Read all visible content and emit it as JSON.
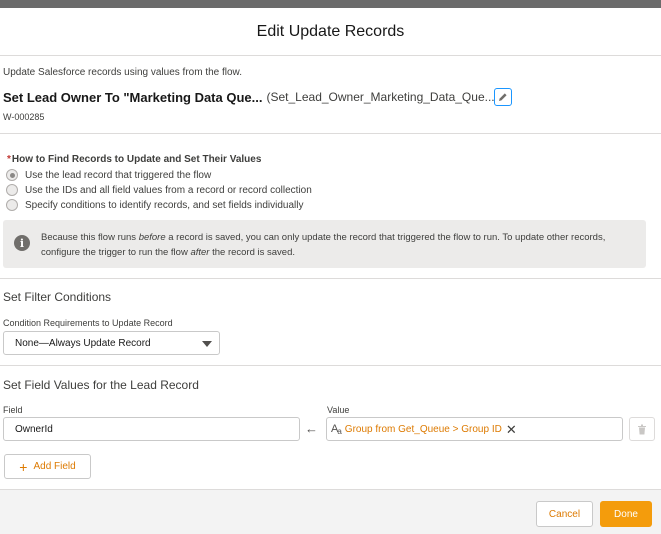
{
  "modal": {
    "title": "Edit Update Records",
    "description": "Update Salesforce records using values from the flow.",
    "element_label": "Set Lead Owner To \"Marketing Data Que...",
    "element_api_name": "(Set_Lead_Owner_Marketing_Data_Que...",
    "element_id": "W-000285"
  },
  "how_to_find": {
    "required_marker": "*",
    "label": "How to Find Records to Update and Set Their Values",
    "options": [
      {
        "label": "Use the lead record that triggered the flow",
        "selected": true
      },
      {
        "label": "Use the IDs and all field values from a record or record collection",
        "selected": false
      },
      {
        "label": "Specify conditions to identify records, and set fields individually",
        "selected": false
      }
    ]
  },
  "info": {
    "text_part1": "Because this flow runs ",
    "text_em1": "before",
    "text_part2": " a record is saved, you can only update the record that triggered the flow to run. To update other records, configure the trigger to run the flow ",
    "text_em2": "after",
    "text_part3": " the record is saved."
  },
  "filter": {
    "section_title": "Set Filter Conditions",
    "requirement_label": "Condition Requirements to Update Record",
    "requirement_value": "None—Always Update Record"
  },
  "field_values": {
    "section_title": "Set Field Values for the Lead Record",
    "field_label": "Field",
    "value_label": "Value",
    "field_value": "OwnerId",
    "value_resource": "Group from Get_Queue > Group ID",
    "add_field_label": "Add Field"
  },
  "footer": {
    "cancel_label": "Cancel",
    "done_label": "Done"
  },
  "colors": {
    "accent": "#dd7a01",
    "primary_button": "#f49c0c",
    "required": "#c23934",
    "edit_border": "#1b96ff"
  },
  "icons": {
    "edit": "pencil-icon",
    "info": "info-icon",
    "arrow": "left-arrow-icon",
    "resource": "text-resource-icon",
    "remove": "close-icon",
    "delete": "trash-icon",
    "add": "plus-icon",
    "dropdown": "chevron-down-icon"
  }
}
